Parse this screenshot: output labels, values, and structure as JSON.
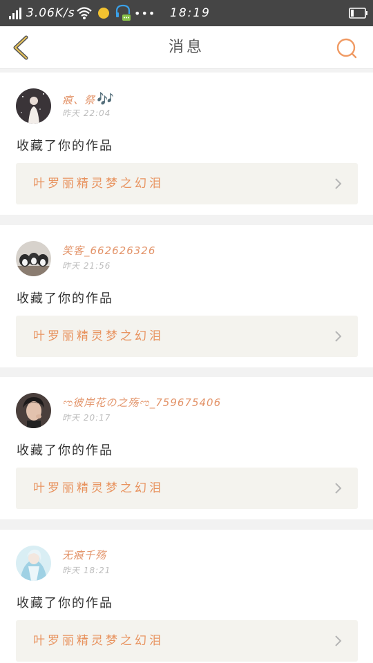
{
  "status_bar": {
    "speed": "3.06K/s",
    "time": "18:19",
    "icons": [
      "signal-icon",
      "wifi-icon",
      "notification-dot-icon",
      "headset-icon",
      "more-icon",
      "battery-icon"
    ],
    "more_glyph": "•••"
  },
  "header": {
    "title": "消息",
    "back_icon": "chevron-left-icon",
    "search_icon": "search-icon",
    "accent_color": "#e8935f"
  },
  "messages": [
    {
      "username": "痕、祭",
      "music_glyph": "🎶",
      "time": "昨天 22:04",
      "action": "收藏了你的作品",
      "work_title": "叶罗丽精灵梦之幻泪"
    },
    {
      "username": "笑客_662626326",
      "time": "昨天 21:56",
      "action": "收藏了你的作品",
      "work_title": "叶罗丽精灵梦之幻泪"
    },
    {
      "username": "ಌ彼岸花の之殇ಌ_759675406",
      "time": "昨天 20:17",
      "action": "收藏了你的作品",
      "work_title": "叶罗丽精灵梦之幻泪"
    },
    {
      "username": "无痕千殇",
      "time": "昨天 18:21",
      "action": "收藏了你的作品",
      "work_title": "叶罗丽精灵梦之幻泪"
    }
  ]
}
